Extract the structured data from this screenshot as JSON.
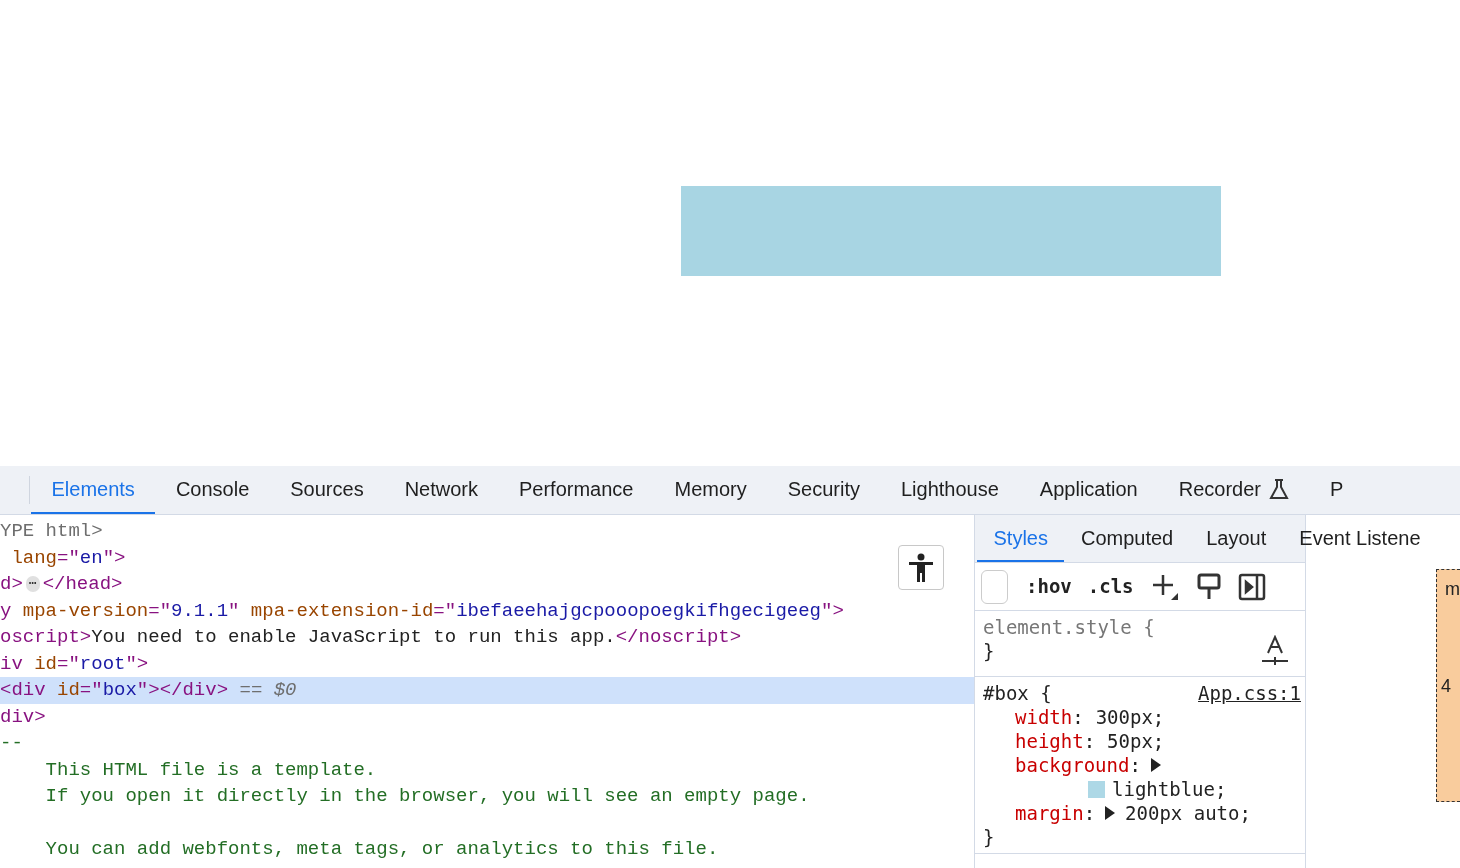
{
  "devtools": {
    "tabs": [
      {
        "label": "Elements",
        "selected": true
      },
      {
        "label": "Console",
        "selected": false
      },
      {
        "label": "Sources",
        "selected": false
      },
      {
        "label": "Network",
        "selected": false
      },
      {
        "label": "Performance",
        "selected": false
      },
      {
        "label": "Memory",
        "selected": false
      },
      {
        "label": "Security",
        "selected": false
      },
      {
        "label": "Lighthouse",
        "selected": false
      },
      {
        "label": "Application",
        "selected": false
      },
      {
        "label": "Recorder",
        "selected": false,
        "kind": "experimental"
      },
      {
        "label": "P",
        "selected": false
      }
    ],
    "elements_lines": [
      {
        "selected": false,
        "segments": [
          {
            "kind": "doctype",
            "text": "YPE html>"
          }
        ]
      },
      {
        "selected": false,
        "segments": [
          {
            "kind": "attr",
            "text": " lang"
          },
          {
            "kind": "tag",
            "text": "=\""
          },
          {
            "kind": "value",
            "text": "en"
          },
          {
            "kind": "tag",
            "text": "\">"
          }
        ]
      },
      {
        "selected": false,
        "segments": [
          {
            "kind": "tag",
            "text": "d>"
          },
          {
            "kind": "badge",
            "text": "⋯"
          },
          {
            "kind": "tag",
            "text": "</head>"
          }
        ]
      },
      {
        "selected": false,
        "segments": [
          {
            "kind": "tag",
            "text": "y"
          },
          {
            "kind": "attr",
            "text": " mpa-version"
          },
          {
            "kind": "tag",
            "text": "=\""
          },
          {
            "kind": "value",
            "text": "9.1.1"
          },
          {
            "kind": "tag",
            "text": "\""
          },
          {
            "kind": "attr",
            "text": " mpa-extension-id"
          },
          {
            "kind": "tag",
            "text": "=\""
          },
          {
            "kind": "value",
            "text": "ibefaeehajgcpooopoegkifhgecigeeg"
          },
          {
            "kind": "tag",
            "text": "\">"
          }
        ]
      },
      {
        "selected": false,
        "segments": [
          {
            "kind": "tag",
            "text": "oscript>"
          },
          {
            "kind": "text",
            "text": "You need to enable JavaScript to run this app."
          },
          {
            "kind": "tag",
            "text": "</noscript>"
          }
        ]
      },
      {
        "selected": false,
        "segments": [
          {
            "kind": "tag",
            "text": "iv"
          },
          {
            "kind": "attr",
            "text": " id"
          },
          {
            "kind": "tag",
            "text": "=\""
          },
          {
            "kind": "value",
            "text": "root"
          },
          {
            "kind": "tag",
            "text": "\">"
          }
        ]
      },
      {
        "selected": true,
        "segments": [
          {
            "kind": "tag",
            "text": "<div"
          },
          {
            "kind": "attr",
            "text": " id"
          },
          {
            "kind": "tag",
            "text": "=\""
          },
          {
            "kind": "value",
            "text": "box"
          },
          {
            "kind": "tag",
            "text": "\"></div>"
          },
          {
            "kind": "marker",
            "text": " == $0"
          }
        ]
      },
      {
        "selected": false,
        "segments": [
          {
            "kind": "tag",
            "text": "div>"
          }
        ]
      },
      {
        "selected": false,
        "segments": [
          {
            "kind": "comment",
            "text": "--"
          }
        ]
      },
      {
        "selected": false,
        "segments": [
          {
            "kind": "comment",
            "text": "    This HTML file is a template."
          }
        ]
      },
      {
        "selected": false,
        "segments": [
          {
            "kind": "comment",
            "text": "    If you open it directly in the browser, you will see an empty page."
          }
        ]
      },
      {
        "selected": false,
        "blank_line_before": true,
        "segments": [
          {
            "kind": "comment",
            "text": "    You can add webfonts, meta tags, or analytics to this file."
          }
        ]
      }
    ],
    "sidebar_tabs": [
      {
        "label": "Styles",
        "selected": true
      },
      {
        "label": "Computed",
        "selected": false
      },
      {
        "label": "Layout",
        "selected": false
      },
      {
        "label": "Event Listene",
        "selected": false
      }
    ],
    "toolbar": {
      "hov": ":hov",
      "cls": ".cls"
    },
    "rules": [
      {
        "selector": "element.style {",
        "kind": "inline",
        "close": "}"
      },
      {
        "selector": "#box {",
        "kind": "stylesheet",
        "source": "App.css:1",
        "close": "}",
        "declarations": [
          {
            "property": "width",
            "separator": ":",
            "value": "300px;"
          },
          {
            "property": "height",
            "separator": ":",
            "value": "50px;"
          },
          {
            "property": "background",
            "separator": ":",
            "expandable": true,
            "value": "lightblue;",
            "color": "#add8e6"
          },
          {
            "property": "margin",
            "separator": ":",
            "expandable": true,
            "value": "200px auto;"
          }
        ]
      }
    ],
    "box_model": {
      "label": "m",
      "value": "4"
    }
  }
}
